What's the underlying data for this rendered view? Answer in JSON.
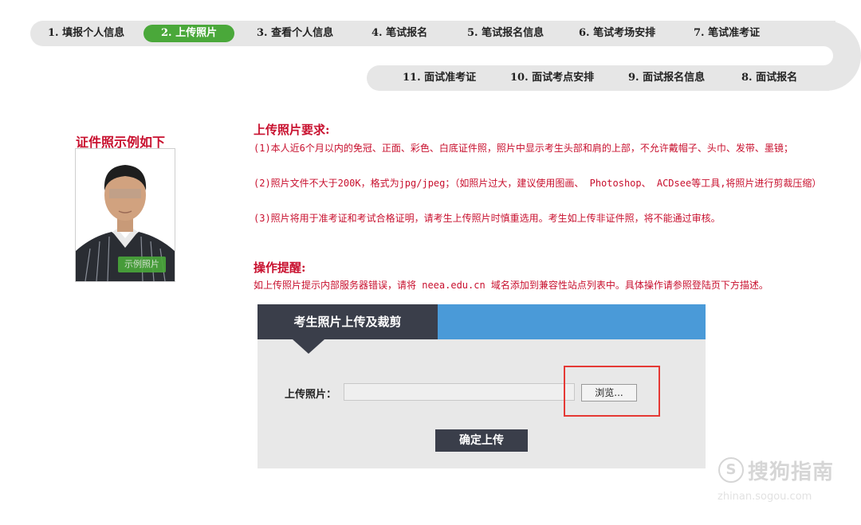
{
  "steps_top": [
    {
      "label": "1. 填报个人信息",
      "active": false
    },
    {
      "label": "2. 上传照片",
      "active": true
    },
    {
      "label": "3. 查看个人信息",
      "active": false
    },
    {
      "label": "4. 笔试报名",
      "active": false
    },
    {
      "label": "5. 笔试报名信息",
      "active": false
    },
    {
      "label": "6. 笔试考场安排",
      "active": false
    },
    {
      "label": "7. 笔试准考证",
      "active": false
    }
  ],
  "steps_bottom": [
    {
      "label": "11. 面试准考证"
    },
    {
      "label": "10. 面试考点安排"
    },
    {
      "label": "9. 面试报名信息"
    },
    {
      "label": "8. 面试报名"
    }
  ],
  "sample": {
    "title": "证件照示例如下",
    "badge": "示例照片"
  },
  "requirements": {
    "title": "上传照片要求:",
    "item1": "(1)本人近6个月以内的免冠、正面、彩色、白底证件照，照片中显示考生头部和肩的上部，不允许戴帽子、头巾、发带、墨镜；",
    "item2": "(2)照片文件不大于200K，格式为jpg/jpeg；（如照片过大，建议使用图画、 Photoshop、 ACDsee等工具,将照片进行剪裁压缩）",
    "item3": "(3)照片将用于准考证和考试合格证明，请考生上传照片时慎重选用。考生如上传非证件照，将不能通过审核。"
  },
  "tips": {
    "title": "操作提醒:",
    "text": "如上传照片提示内部服务器错误，请将 neea.edu.cn 域名添加到兼容性站点列表中。具体操作请参照登陆页下方描述。"
  },
  "upload_panel": {
    "tab_title": "考生照片上传及裁剪",
    "label": "上传照片：",
    "browse_label": "浏览...",
    "confirm_label": "确定上传"
  },
  "watermark": {
    "logo": "S",
    "main": "搜狗指南",
    "sub": "zhinan.sogou.com"
  },
  "colors": {
    "accent_green": "#4aa83a",
    "required_red": "#c8102e",
    "panel_blue": "#4a9ad8",
    "panel_dark": "#3a3e4a",
    "highlight_red": "#e53935"
  }
}
